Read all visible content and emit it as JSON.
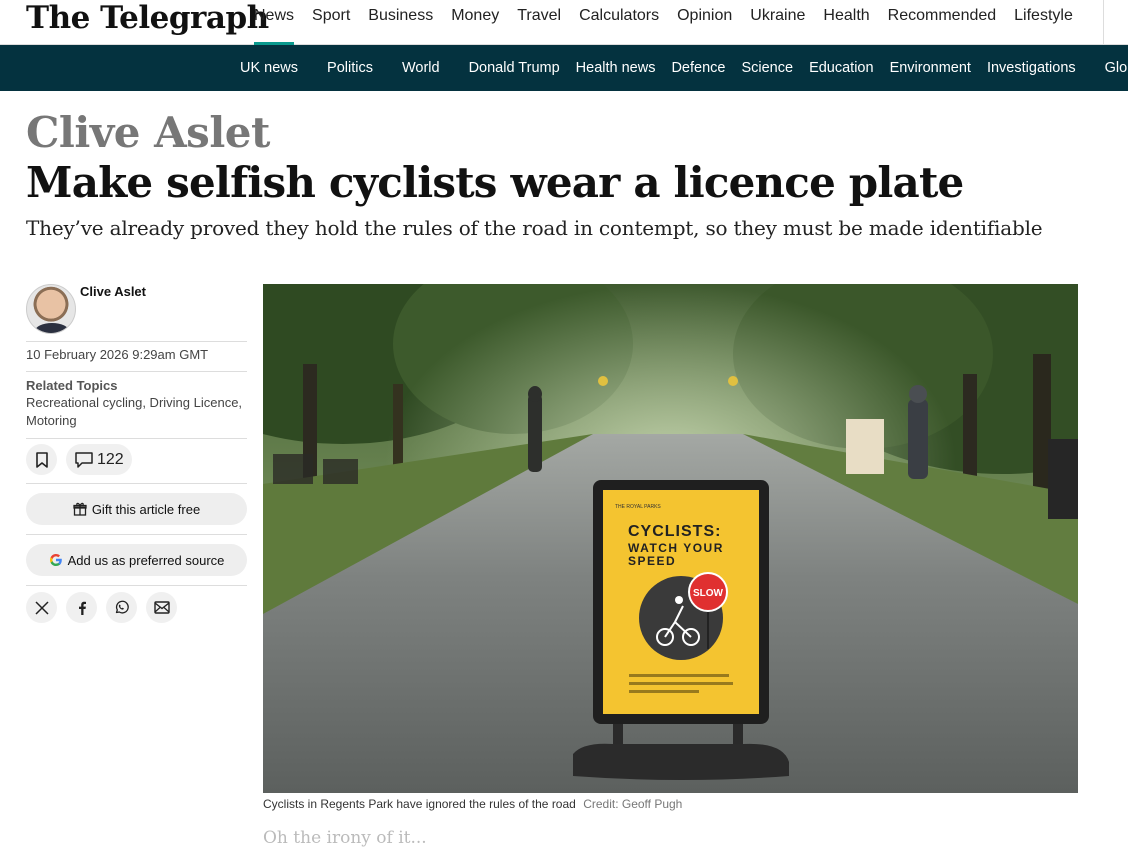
{
  "header": {
    "logo": "The Telegraph",
    "nav": [
      "News",
      "Sport",
      "Business",
      "Money",
      "Travel",
      "Calculators",
      "Opinion",
      "Ukraine",
      "Health",
      "Recommended",
      "Lifestyle"
    ],
    "active_nav": "News"
  },
  "subnav": [
    "UK news",
    "Politics",
    "World",
    "Donald Trump",
    "Health news",
    "Defence",
    "Science",
    "Education",
    "Environment",
    "Investigations",
    "Glo"
  ],
  "article": {
    "kicker": "Clive Aslet",
    "headline": "Make selfish cyclists wear a licence plate",
    "standfirst": "They’ve already proved they hold the rules of the road in contempt, so they must be made identifiable",
    "author": "Clive Aslet",
    "date": "10 February 2026 9:29am GMT",
    "topics_label": "Related Topics",
    "topics": "Recreational cycling, Driving Licence, Motoring",
    "comment_count": "122",
    "gift_label": "Gift this article free",
    "preferred_source_label": "Add us as preferred source",
    "share_icons": [
      "x-icon",
      "facebook-icon",
      "whatsapp-icon",
      "email-icon"
    ],
    "image_sign": {
      "org": "THE ROYAL PARKS",
      "line1": "CYCLISTS:",
      "line2": "WATCH YOUR",
      "line3": "SPEED",
      "slow": "SLOW",
      "small": "Ride at a safe speed at all times. Slow down when the park is busy."
    },
    "caption": "Cyclists in Regents Park have ignored the rules of the road",
    "credit": "Credit: Geoff Pugh",
    "body_first_line": "Oh the irony of it..."
  },
  "colors": {
    "accent": "#0a9a8e",
    "subnav_bg": "#04323f",
    "sign_yellow": "#f4c430"
  }
}
